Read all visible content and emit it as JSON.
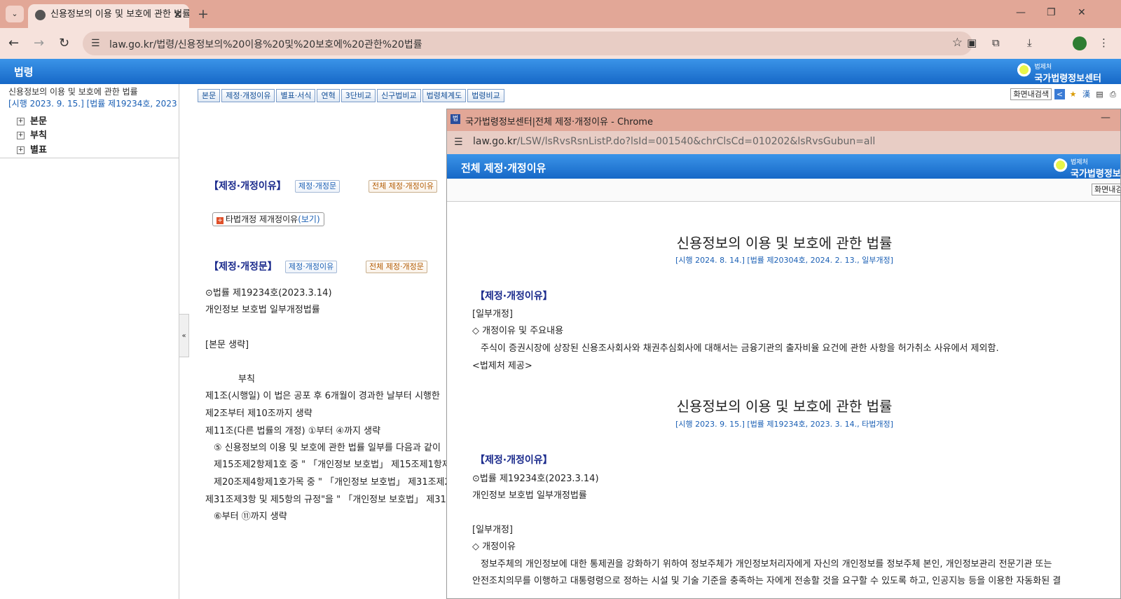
{
  "browser": {
    "tab_title": "신용정보의 이용 및 보호에 관한 법률",
    "url": "law.go.kr/법령/신용정보의%20이용%20및%20보호에%20관한%20법률"
  },
  "site": {
    "title": "법령",
    "logo_small": "법제처",
    "logo_large": "국가법령정보센터"
  },
  "left_panel": {
    "law_title": "신용정보의 이용 및 보호에 관한 법률",
    "law_meta": "[시행 2023. 9. 15.] [법률 제19234호, 2023. 3. 14., 타법개정]",
    "tree": [
      "본문",
      "부칙",
      "별표"
    ]
  },
  "toolbar_buttons": [
    "본문",
    "제정·개정이유",
    "별표·서식",
    "연혁",
    "3단비교",
    "신구법비교",
    "법령체계도",
    "법령비교"
  ],
  "right_tools": {
    "search": "화면내검색",
    "hanja": "漢"
  },
  "main": {
    "reason_heading": "【제정·개정이유】",
    "reason_btn1": "제정·개정문",
    "reason_btn2": "전체 제정·개정이유",
    "other_law_prefix": "타법개정 제개정이유",
    "other_law_link": "(보기)",
    "text_heading": "【제정·개정문】",
    "text_btn1": "제정·개정이유",
    "text_btn2": "전체 제정·개정문",
    "lines": [
      "⊙법률 제19234호(2023.3.14)",
      "개인정보 보호법 일부개정법률",
      "",
      "[본문 생략]",
      "",
      "부칙",
      "제1조(시행일) 이 법은 공포 후 6개월이 경과한 날부터 시행한",
      "제2조부터 제10조까지 생략",
      "제11조(다른 법률의 개정) ①부터 ④까지 생략",
      "⑤ 신용정보의 이용 및 보호에 관한 법률 일부를 다음과 같이",
      "제15조제2항제1호 중 \" 「개인정보 보호법」 제15조제1항제",
      "제20조제4항제1호가목 중 \" 「개인정보 보호법」 제31조제2",
      "제31조제3항 및 제5항의 규정\"을 \" 「개인정보 보호법」 제31조",
      "⑥부터 ⑪까지 생략"
    ]
  },
  "popup": {
    "window_title": "국가법령정보센터|전체 제정·개정이유 - Chrome",
    "url_host": "law.go.kr",
    "url_path": "/LSW/lsRvsRsnListP.do?lsId=001540&chrClsCd=010202&lsRvsGubun=all",
    "header_title": "전체 제정·개정이유",
    "search": "화면내검색",
    "blocks": [
      {
        "title": "신용정보의 이용 및 보호에 관한 법률",
        "meta": "[시행 2024. 8. 14.] [법률 제20304호, 2024. 2. 13., 일부개정]",
        "heading": "【제정·개정이유】",
        "lines": [
          "[일부개정]",
          "◇ 개정이유 및 주요내용",
          "주식이 증권시장에 상장된 신용조사회사와 채권추심회사에 대해서는 금융기관의 출자비율 요건에 관한 사항을 허가취소 사유에서 제외함.",
          "<법제처 제공>"
        ]
      },
      {
        "title": "신용정보의 이용 및 보호에 관한 법률",
        "meta": "[시행 2023. 9. 15.] [법률 제19234호, 2023. 3. 14., 타법개정]",
        "heading": "【제정·개정이유】",
        "lines": [
          "⊙법률 제19234호(2023.3.14)",
          "개인정보 보호법 일부개정법률",
          "",
          "[일부개정]",
          "◇ 개정이유",
          "정보주체의 개인정보에 대한 통제권을 강화하기 위하여 정보주체가 개인정보처리자에게 자신의 개인정보를 정보주체 본인, 개인정보관리 전문기관 또는",
          "안전조치의무를 이행하고 대통령령으로 정하는 시설 및 기술 기준을 충족하는 자에게 전송할 것을 요구할 수 있도록 하고, 인공지능 등을 이용한 자동화된 결"
        ]
      }
    ]
  }
}
